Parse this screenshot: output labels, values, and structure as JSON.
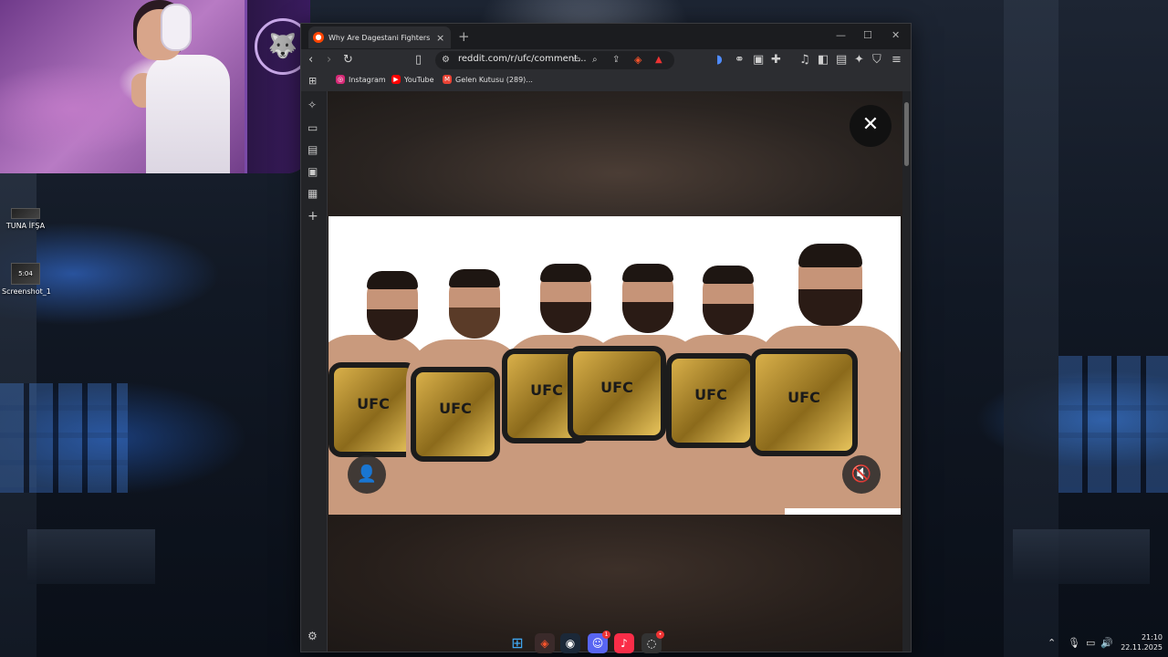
{
  "desktop": {
    "icons": [
      {
        "label": "TUNA İFŞA"
      },
      {
        "label": "Screenshot_1",
        "thumb_text": "5:04"
      }
    ]
  },
  "browser": {
    "tab": {
      "title": "Why Are Dagestani Fighters Stu",
      "favicon": "reddit-icon"
    },
    "new_tab": "+",
    "window_controls": {
      "minimize": "—",
      "maximize": "☐",
      "close": "✕"
    },
    "address_bar": {
      "url": "reddit.com/r/ufc/comment..."
    },
    "bookmarks": [
      {
        "label": "Instagram",
        "icon": "instagram-icon",
        "color": "#d62976"
      },
      {
        "label": "YouTube",
        "icon": "youtube-icon",
        "color": "#ff0000"
      },
      {
        "label": "Gelen Kutusu (289)...",
        "icon": "gmail-icon",
        "color": "#ea4335"
      }
    ]
  },
  "media_viewer": {
    "close": "✕",
    "belt_text": "UFC",
    "icons": {
      "avatar": "user-icon",
      "sound": "mute-icon"
    }
  },
  "taskbar": {
    "apps": [
      {
        "name": "windows-start"
      },
      {
        "name": "brave-browser"
      },
      {
        "name": "steam"
      },
      {
        "name": "discord",
        "badge": "1"
      },
      {
        "name": "apple-music"
      },
      {
        "name": "other-app",
        "badge": "•"
      }
    ],
    "clock": {
      "time": "21:10",
      "date": "22.11.2025"
    }
  }
}
